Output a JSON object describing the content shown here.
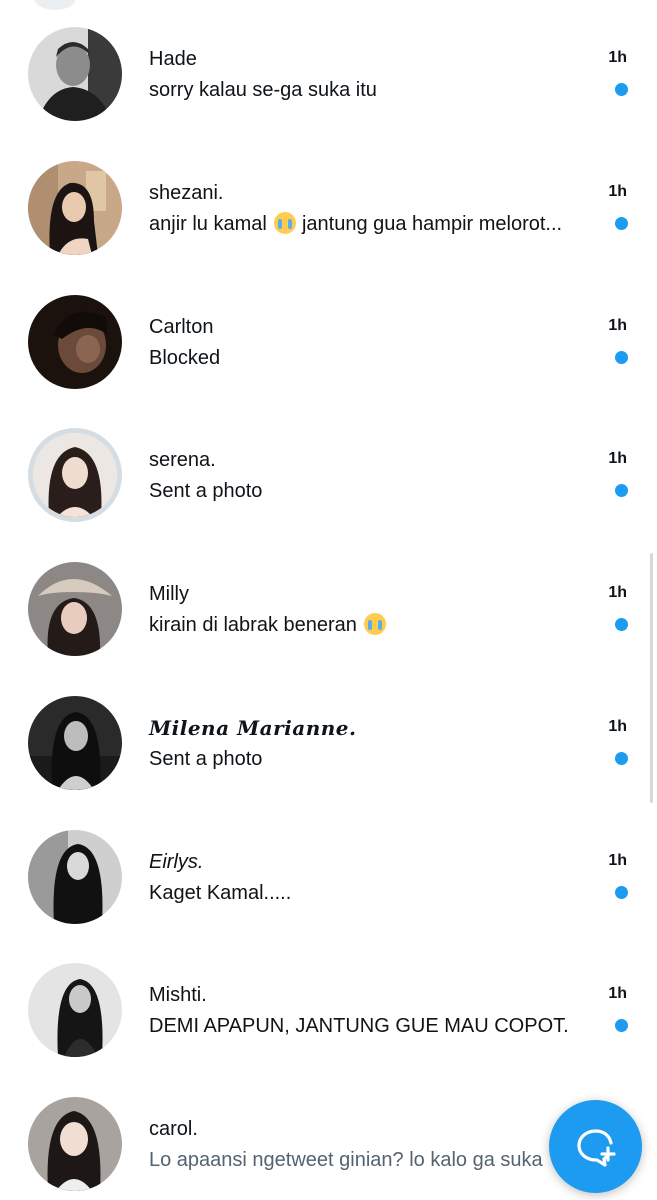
{
  "colors": {
    "accent": "#1d9bf0",
    "text_primary": "#0f1419",
    "text_secondary": "#536471"
  },
  "conversations": [
    {
      "name": "Hade",
      "preview": "sorry kalau se-ga suka itu",
      "time": "1h",
      "unread": true,
      "avatar": "photo-avatar"
    },
    {
      "name": "shezani.",
      "preview": "anjir lu kamal",
      "preview_emoji": "loudly-crying-face",
      "preview_after": "jantung gua hampir melorot...",
      "time": "1h",
      "unread": true,
      "avatar": "photo-avatar"
    },
    {
      "name": "Carlton",
      "preview": "Blocked",
      "time": "1h",
      "unread": true,
      "avatar": "photo-avatar"
    },
    {
      "name": "serena.",
      "preview": "Sent a photo",
      "time": "1h",
      "unread": true,
      "avatar": "photo-avatar-ringed"
    },
    {
      "name": "Milly",
      "preview": "kirain di labrak beneran",
      "preview_emoji": "loudly-crying-face",
      "time": "1h",
      "unread": true,
      "avatar": "photo-avatar"
    },
    {
      "name": "𝑴𝒊𝒍𝒆𝒏𝒂 𝑴𝒂𝒓𝒊𝒂𝒏𝒏𝒆.",
      "preview": "Sent a photo",
      "time": "1h",
      "unread": true,
      "avatar": "photo-avatar"
    },
    {
      "name": "Eirlys.",
      "preview": "Kaget Kamal.....",
      "time": "1h",
      "unread": true,
      "avatar": "photo-avatar"
    },
    {
      "name": "Mishti.",
      "preview": "DEMI APAPUN, JANTUNG GUE MAU COPOT.",
      "time": "1h",
      "unread": true,
      "avatar": "photo-avatar"
    },
    {
      "name": "carol.",
      "preview": "Lo apaansi ngetweet ginian? lo kalo ga suka",
      "time": "",
      "unread": false,
      "avatar": "photo-avatar"
    }
  ],
  "fab": {
    "icon": "new-message-icon"
  }
}
